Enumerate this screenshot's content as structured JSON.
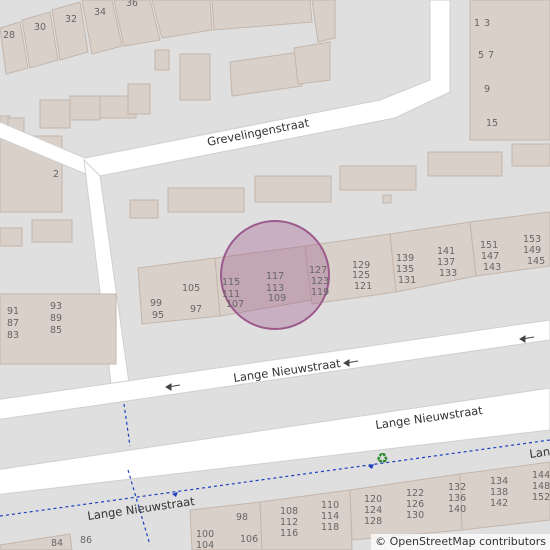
{
  "map": {
    "streets": [
      {
        "name": "Grevelingenstraat"
      },
      {
        "name": "Lange Nieuwstraat"
      },
      {
        "name": "Lange Nieuwstraat"
      },
      {
        "name": "Lange Nieuwstraat"
      },
      {
        "name": "Lan"
      }
    ],
    "house_numbers": [
      "28",
      "30",
      "32",
      "34",
      "36",
      "1",
      "3",
      "5",
      "7",
      "9",
      "15",
      "2",
      "91",
      "87",
      "83",
      "93",
      "89",
      "85",
      "99",
      "95",
      "97",
      "105",
      "115",
      "111",
      "107",
      "117",
      "113",
      "109",
      "127",
      "123",
      "119",
      "129",
      "125",
      "121",
      "139",
      "135",
      "131",
      "141",
      "137",
      "133",
      "151",
      "147",
      "143",
      "153",
      "149",
      "145",
      "84",
      "86",
      "98",
      "100",
      "104",
      "106",
      "108",
      "112",
      "116",
      "110",
      "114",
      "118",
      "120",
      "124",
      "128",
      "122",
      "126",
      "130",
      "132",
      "136",
      "140",
      "134",
      "138",
      "142",
      "144",
      "148",
      "152"
    ],
    "marker": {
      "type": "circle-highlight",
      "color": "#9b5a8c"
    },
    "poi_icon": "recycling-icon",
    "colors": {
      "background": "#e0dfdf",
      "building": "#d9d0c9",
      "road": "#ffffff",
      "footpath": "#1a3fbf"
    }
  },
  "attribution": {
    "symbol": "©",
    "text": "OpenStreetMap contributors"
  }
}
